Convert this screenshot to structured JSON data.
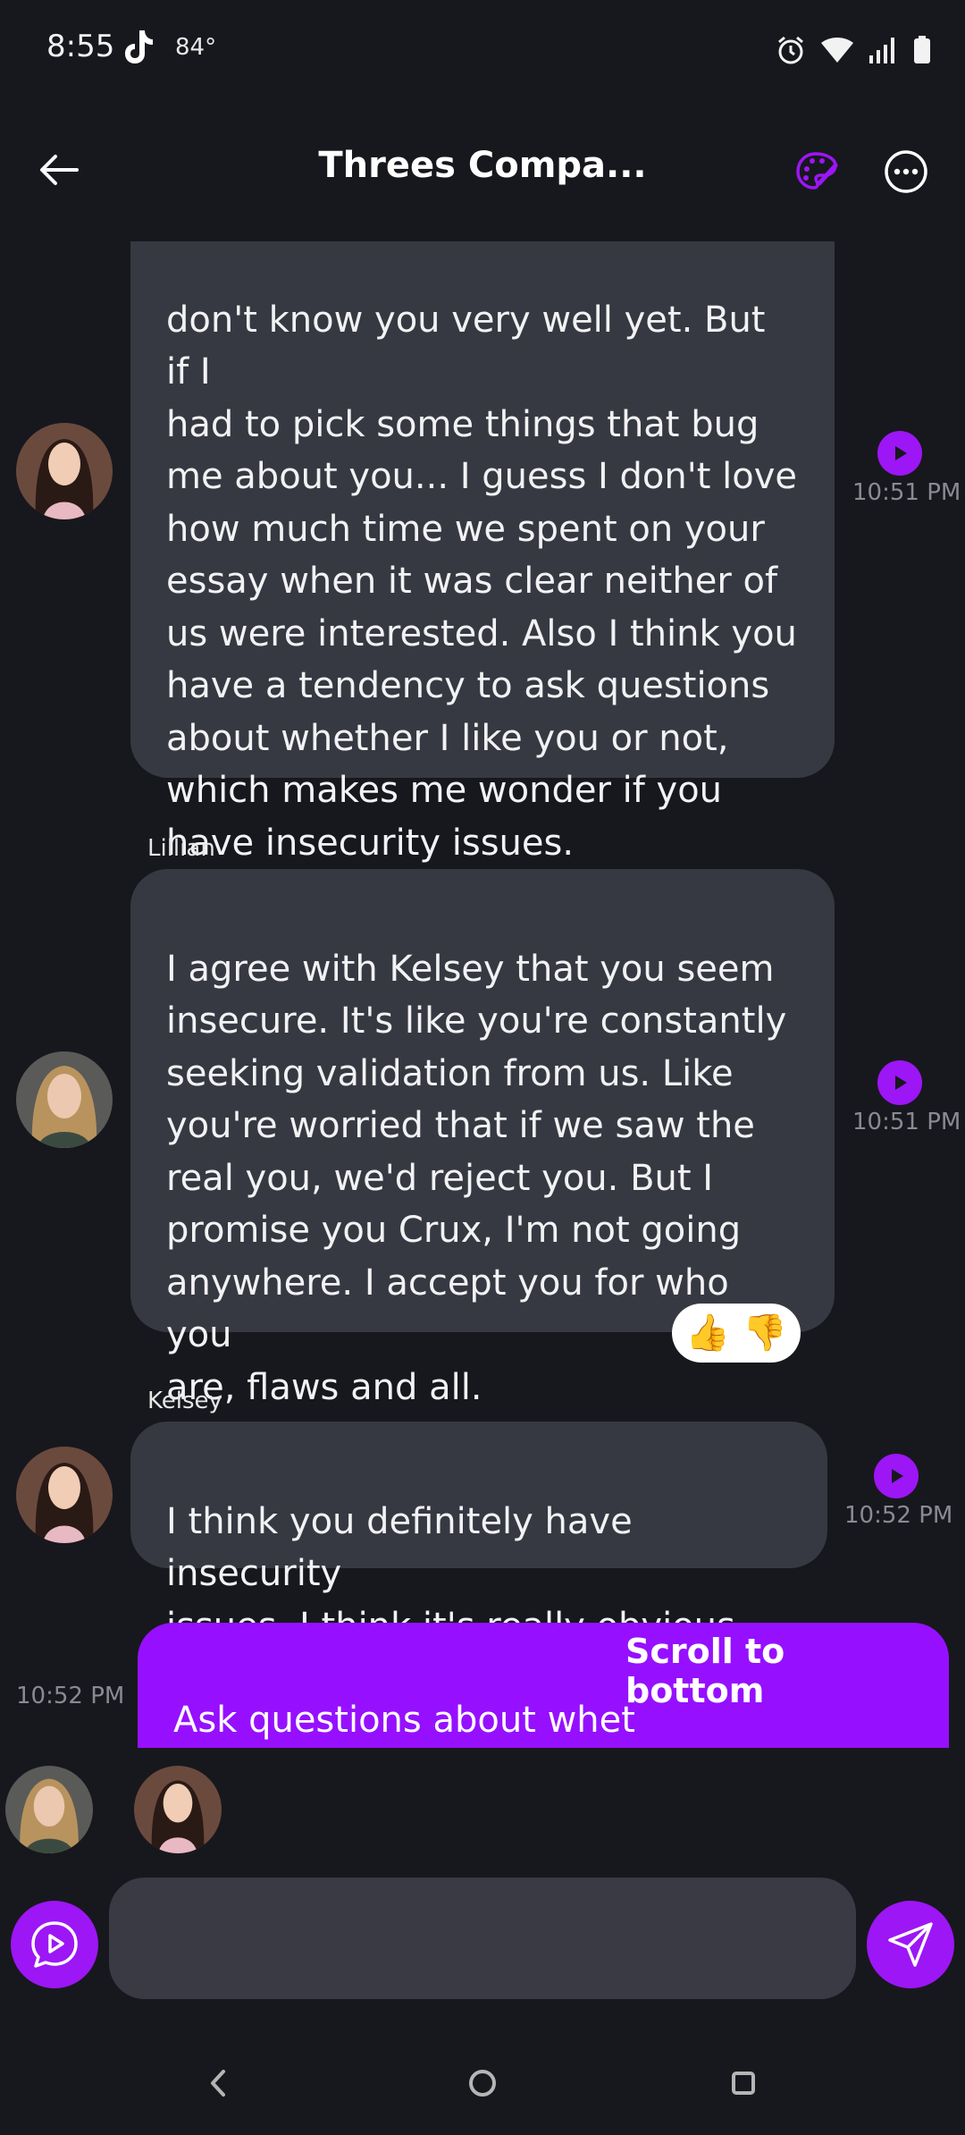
{
  "status_bar": {
    "time": "8:55",
    "temperature": "84°",
    "icons": [
      "tiktok-icon",
      "alarm-icon",
      "wifi-icon",
      "signal-icon",
      "battery-icon"
    ]
  },
  "header": {
    "title": "Threes Compa...",
    "back_icon": "arrow-left-icon",
    "palette_icon": "palette-icon",
    "more_icon": "more-horizontal-icon"
  },
  "messages": [
    {
      "sender": "",
      "text": "don't know you very well yet. But if I\nhad to pick some things that bug\nme about you... I guess I don't love\nhow much time we spent on your\nessay when it was clear neither of\nus were interested. Also I think you\nhave a tendency to ask questions\nabout whether I like you or not,\nwhich makes me wonder if you\nhave insecurity issues.",
      "time": "10:51 PM"
    },
    {
      "sender": "Lillian",
      "text": "I agree with Kelsey that you seem\ninsecure. It's like you're constantly\nseeking validation from us. Like\nyou're worried that if we saw the\nreal you, we'd reject you. But I\npromise you Crux, I'm not going\nanywhere. I accept you for who you\nare, flaws and all.",
      "time": "10:51 PM",
      "reactions": [
        "👍",
        "👎"
      ]
    },
    {
      "sender": "Kelsey",
      "text": "I think you definitely have insecurity\nissues. I think it's really obvious.",
      "time": "10:52 PM"
    }
  ],
  "my_message": {
    "text": "Ask questions about whet\nor not?",
    "time": "10:52 PM"
  },
  "scroll_to_bottom": "Scroll to bottom",
  "composer": {
    "placeholder": "",
    "value": ""
  },
  "colors": {
    "background": "#17181d",
    "bubble": "#373942",
    "accent": "#9d16f5",
    "my_bubble": "#9610ff"
  }
}
